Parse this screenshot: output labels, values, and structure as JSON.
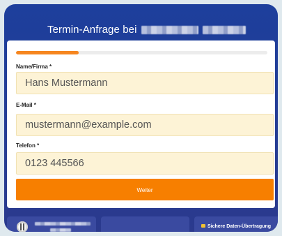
{
  "header": {
    "title": "Termin-Anfrage bei"
  },
  "form": {
    "progress_percent": 25,
    "name": {
      "label": "Name/Firma *",
      "value": "Hans Mustermann"
    },
    "email": {
      "label": "E-Mail *",
      "value": "mustermann@example.com"
    },
    "phone": {
      "label": "Telefon *",
      "value": "0123 445566"
    },
    "submit_label": "Weiter"
  },
  "footer": {
    "secure_label": "Sichere Daten-Übertragung"
  },
  "colors": {
    "accent": "#f77f00",
    "header_bg": "#1d3f9c",
    "field_bg": "#fdf3d6"
  }
}
